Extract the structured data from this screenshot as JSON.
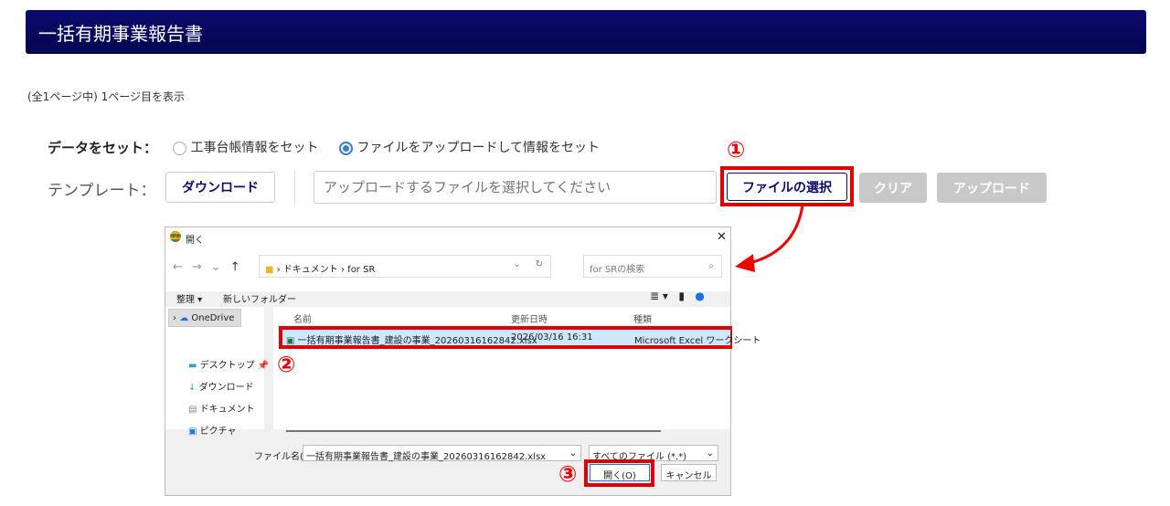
{
  "header": {
    "title": "一括有期事業報告書"
  },
  "page_info": "(全1ページ中) 1ページ目を表示",
  "data_set": {
    "label": "データをセット：",
    "options": [
      {
        "label": "工事台帳情報をセット",
        "selected": false
      },
      {
        "label": "ファイルをアップロードして情報をセット",
        "selected": true
      }
    ]
  },
  "template": {
    "label": "テンプレート：",
    "download": "ダウンロード",
    "file_placeholder": "アップロードするファイルを選択してください",
    "select_file": "ファイルの選択",
    "clear": "クリア",
    "upload": "アップロード"
  },
  "steps": [
    "①",
    "②",
    "③"
  ],
  "dialog": {
    "title": "開く",
    "breadcrumb": [
      "ドキュメント",
      "for SR"
    ],
    "search_placeholder": "for SRの検索",
    "organize": "整理 ▾",
    "new_folder": "新しいフォルダー",
    "nav": [
      "OneDrive",
      "デスクトップ",
      "ダウンロード",
      "ドキュメント",
      "ピクチャ"
    ],
    "columns": [
      "名前",
      "更新日時",
      "種類"
    ],
    "files": [
      {
        "name": "一括有期事業報告書_建設の事業_20260316162842.xlsx",
        "modified": "2026/03/16 16:31",
        "type": "Microsoft Excel ワークシート"
      }
    ],
    "filename_label": "ファイル名(N):",
    "filename_value": "一括有期事業報告書_建設の事業_20260316162842.xlsx",
    "filter": "すべてのファイル (*.*)",
    "open": "開く(O)",
    "cancel": "キャンセル"
  },
  "colors": {
    "header": "#0b0b6e",
    "highlight": "#e00000"
  }
}
